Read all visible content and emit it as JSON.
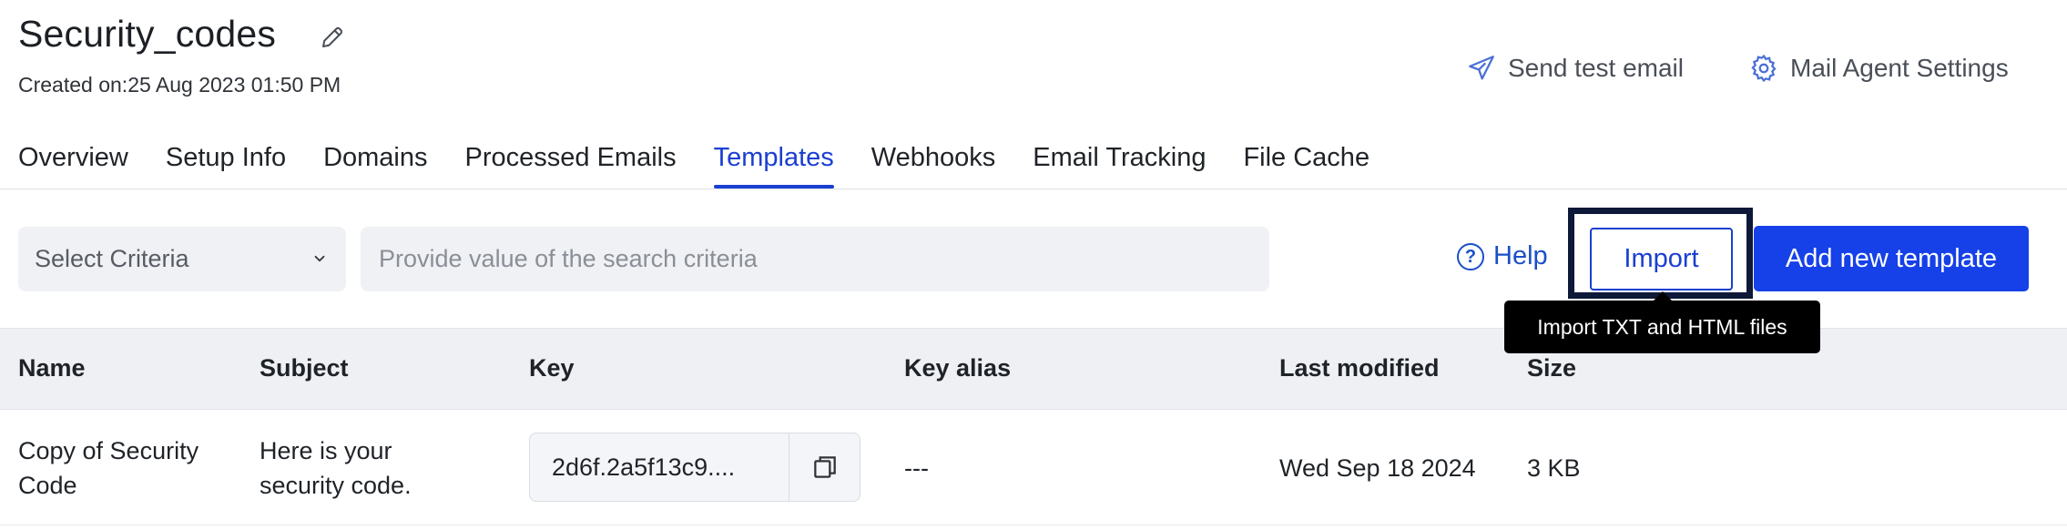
{
  "header": {
    "title": "Security_codes",
    "created": "Created on:25 Aug 2023 01:50 PM",
    "send_test_label": "Send test email",
    "mail_settings_label": "Mail Agent Settings"
  },
  "tabs": [
    {
      "label": "Overview",
      "active": false
    },
    {
      "label": "Setup Info",
      "active": false
    },
    {
      "label": "Domains",
      "active": false
    },
    {
      "label": "Processed Emails",
      "active": false
    },
    {
      "label": "Templates",
      "active": true
    },
    {
      "label": "Webhooks",
      "active": false
    },
    {
      "label": "Email Tracking",
      "active": false
    },
    {
      "label": "File Cache",
      "active": false
    }
  ],
  "toolbar": {
    "criteria_value": "Select Criteria",
    "search_placeholder": "Provide value of the search criteria",
    "help_label": "Help",
    "import_label": "Import",
    "add_label": "Add new template",
    "import_tooltip": "Import TXT and HTML files"
  },
  "table": {
    "columns": [
      "Name",
      "Subject",
      "Key",
      "Key alias",
      "Last modified",
      "Size"
    ],
    "rows": [
      {
        "name_line1": "Copy of Security",
        "name_line2": "Code",
        "subject_line1": "Here is your",
        "subject_line2": "security code.",
        "key": "2d6f.2a5f13c9....",
        "key_alias": "---",
        "last_modified": "Wed Sep 18 2024",
        "size": "3 KB"
      }
    ]
  },
  "colors": {
    "accent": "#1a3fd1",
    "primary_button": "#1641e8",
    "focus_ring": "#0e1838"
  }
}
